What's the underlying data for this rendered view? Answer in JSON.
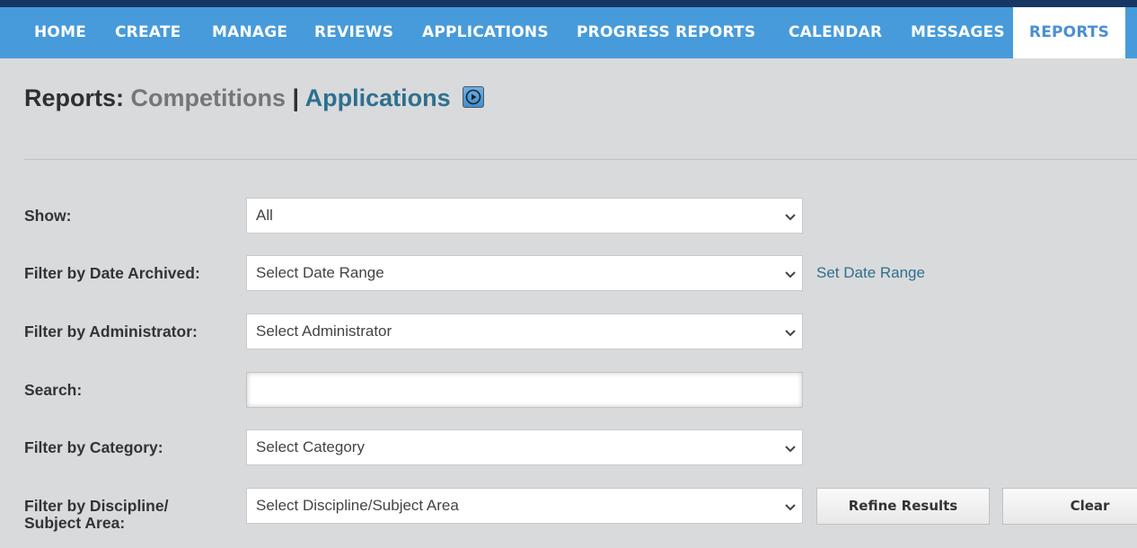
{
  "nav": {
    "items": [
      {
        "label": "HOME",
        "active": false
      },
      {
        "label": "CREATE",
        "active": false
      },
      {
        "label": "MANAGE",
        "active": false
      },
      {
        "label": "REVIEWS",
        "active": false
      },
      {
        "label": "APPLICATIONS",
        "active": false
      },
      {
        "label": "PROGRESS REPORTS",
        "active": false
      },
      {
        "label": "CALENDAR",
        "active": false
      },
      {
        "label": "MESSAGES",
        "active": false
      },
      {
        "label": "REPORTS",
        "active": true
      }
    ]
  },
  "header": {
    "prefix": "Reports:",
    "competitions": "Competitions",
    "separator": "|",
    "applications": "Applications",
    "play_icon": "play-circle-icon"
  },
  "filters": {
    "show": {
      "label": "Show:",
      "value": "All"
    },
    "date_archived": {
      "label": "Filter by Date Archived:",
      "value": "Select Date Range",
      "link": "Set Date Range"
    },
    "administrator": {
      "label": "Filter by Administrator:",
      "value": "Select Administrator"
    },
    "search": {
      "label": "Search:",
      "value": ""
    },
    "category": {
      "label": "Filter by Category:",
      "value": "Select Category"
    },
    "discipline": {
      "label_line1": "Filter by Discipline/",
      "label_line2": "Subject Area:",
      "value": "Select Discipline/Subject Area"
    }
  },
  "actions": {
    "refine": "Refine Results",
    "clear": "Clear"
  },
  "colors": {
    "nav_bg": "#479bdb",
    "top_strip": "#173663",
    "link": "#2e6f8e",
    "page_bg": "#d9dadc"
  }
}
